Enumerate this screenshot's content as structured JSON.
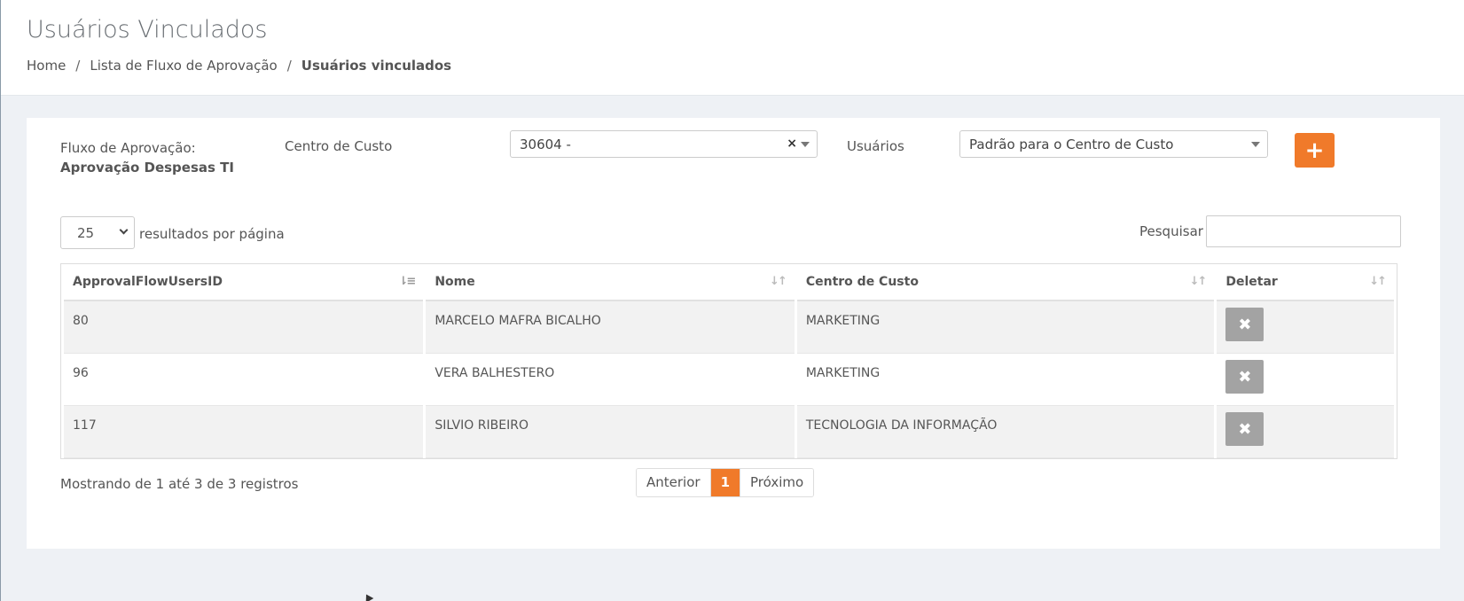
{
  "header": {
    "title": "Usuários Vinculados",
    "breadcrumb": [
      "Home",
      "Lista de Fluxo de Aprovação",
      "Usuários vinculados"
    ],
    "separator": "/"
  },
  "filters": {
    "flow_label": "Fluxo de Aprovação:",
    "flow_value": "Aprovação Despesas TI",
    "cost_center_label": "Centro de Custo",
    "cost_center_value": "30604 -",
    "clear_symbol": "×",
    "users_label": "Usuários",
    "users_value": "Padrão para o Centro de Custo",
    "add_symbol": "+"
  },
  "table_controls": {
    "page_length": "25",
    "page_length_label": "resultados por página",
    "search_label": "Pesquisar",
    "search_value": ""
  },
  "table": {
    "columns": [
      "ApprovalFlowUsersID",
      "Nome",
      "Centro de Custo",
      "Deletar"
    ],
    "rows": [
      {
        "id": "80",
        "nome": "MARCELO MAFRA BICALHO",
        "centro": "MARKETING"
      },
      {
        "id": "96",
        "nome": "VERA BALHESTERO",
        "centro": "MARKETING"
      },
      {
        "id": "117",
        "nome": "SILVIO RIBEIRO",
        "centro": "TECNOLOGIA DA INFORMAÇÃO"
      }
    ],
    "delete_symbol": "✖"
  },
  "footer": {
    "info": "Mostrando de 1 até 3 de 3 registros",
    "prev": "Anterior",
    "current_page": "1",
    "next": "Próximo"
  },
  "colors": {
    "accent": "#f07a2a",
    "delete_button": "#a3a3a3"
  }
}
